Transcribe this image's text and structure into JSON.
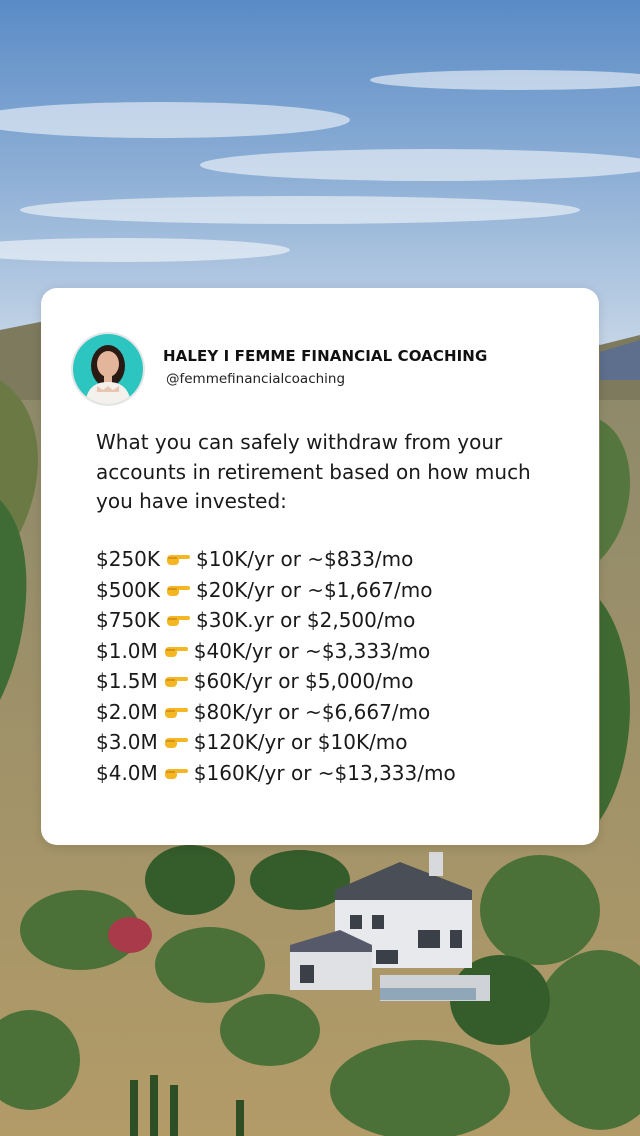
{
  "post": {
    "author_name": "HALEY I FEMME FINANCIAL COACHING",
    "handle": "@femmefinancialcoaching",
    "intro": "What you can safely withdraw from your accounts in retirement based on how much you have invested:",
    "rows": [
      {
        "amount": "$250K",
        "withdrawal": "$10K/yr or ~$833/mo"
      },
      {
        "amount": "$500K",
        "withdrawal": "$20K/yr or ~$1,667/mo"
      },
      {
        "amount": "$750K",
        "withdrawal": "$30K.yr or $2,500/mo"
      },
      {
        "amount": "$1.0M",
        "withdrawal": "$40K/yr or ~$3,333/mo"
      },
      {
        "amount": "$1.5M",
        "withdrawal": "$60K/yr or $5,000/mo"
      },
      {
        "amount": "$2.0M",
        "withdrawal": "$80K/yr or ~$6,667/mo"
      },
      {
        "amount": "$3.0M",
        "withdrawal": "$120K/yr or $10K/mo"
      },
      {
        "amount": "$4.0M",
        "withdrawal": "$160K/yr or ~$13,333/mo"
      }
    ],
    "row_icon": "pointing-right-hand-icon"
  },
  "colors": {
    "card": "#ffffff",
    "text": "#1a1a1a",
    "avatar_bg": "#2cc5c0",
    "sky_top": "#5f8fc8",
    "sky_bottom": "#c9d9ea"
  }
}
